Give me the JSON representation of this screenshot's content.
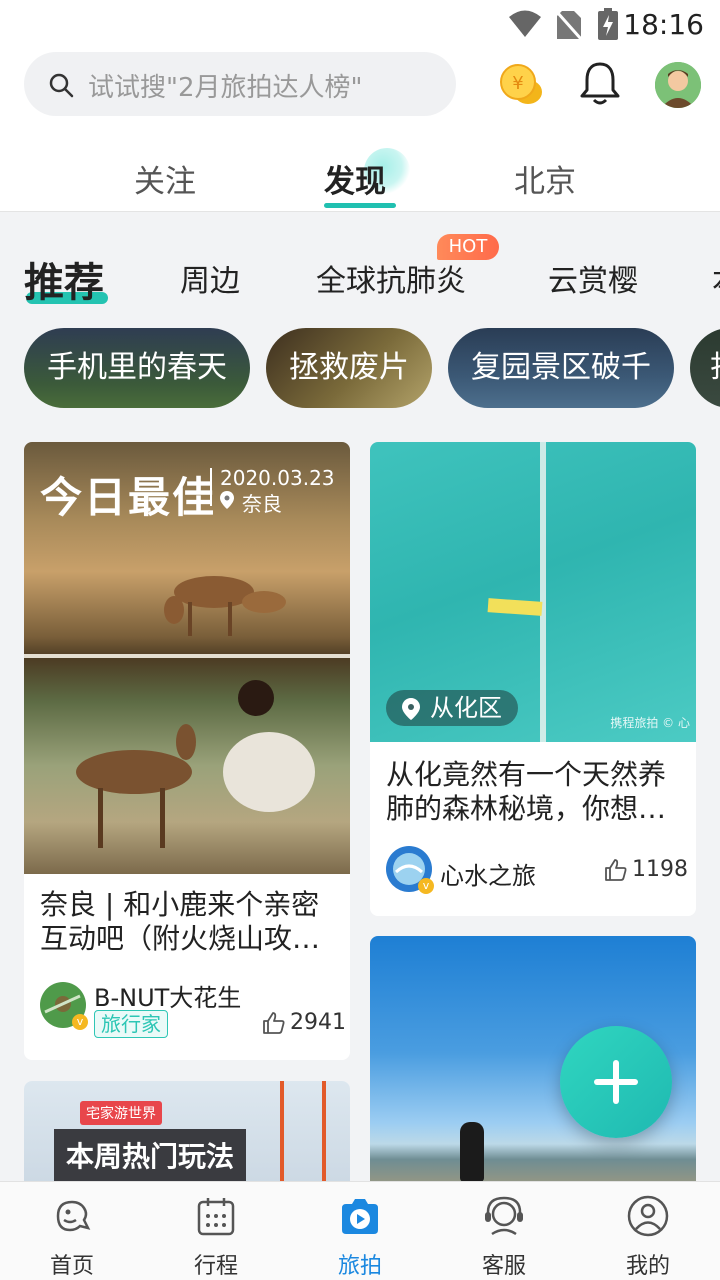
{
  "status_bar": {
    "time": "18:16"
  },
  "header": {
    "search_placeholder": "试试搜\"2月旅拍达人榜\"",
    "tabs": [
      {
        "label": "关注",
        "active": false
      },
      {
        "label": "发现",
        "active": true
      },
      {
        "label": "北京",
        "active": false
      }
    ]
  },
  "categories": {
    "items": [
      {
        "label": "推荐",
        "active": true
      },
      {
        "label": "周边"
      },
      {
        "label": "全球抗肺炎",
        "badge": "HOT"
      },
      {
        "label": "云赏樱"
      },
      {
        "label": "本"
      }
    ]
  },
  "chips": [
    "手机里的春天",
    "拯救废片",
    "复园景区破千",
    "打"
  ],
  "feed": {
    "card1": {
      "banner_title": "今日最佳",
      "banner_date": "2020.03.23",
      "banner_place": "奈良",
      "title": "奈良 | 和小鹿来个亲密互动吧（附火烧山攻…",
      "author": "B-NUT大花生",
      "author_tag": "旅行家",
      "likes": "2941"
    },
    "card2": {
      "location": "从化区",
      "watermark": "携程旅拍 © 心",
      "title": "从化竟然有一个天然养肺的森林秘境，你想…",
      "author": "心水之旅",
      "likes": "1198"
    },
    "card3": {
      "promo_tag": "宅家游世界",
      "promo_title": "本周热门玩法"
    }
  },
  "bottom_nav": [
    {
      "label": "首页",
      "icon": "home-icon",
      "active": false
    },
    {
      "label": "行程",
      "icon": "calendar-icon",
      "active": false
    },
    {
      "label": "旅拍",
      "icon": "camera-play-icon",
      "active": true
    },
    {
      "label": "客服",
      "icon": "headset-icon",
      "active": false
    },
    {
      "label": "我的",
      "icon": "profile-icon",
      "active": false
    }
  ],
  "colors": {
    "accent": "#24c3b1",
    "nav_active": "#1b88e0",
    "hot": "#ff7a52"
  }
}
